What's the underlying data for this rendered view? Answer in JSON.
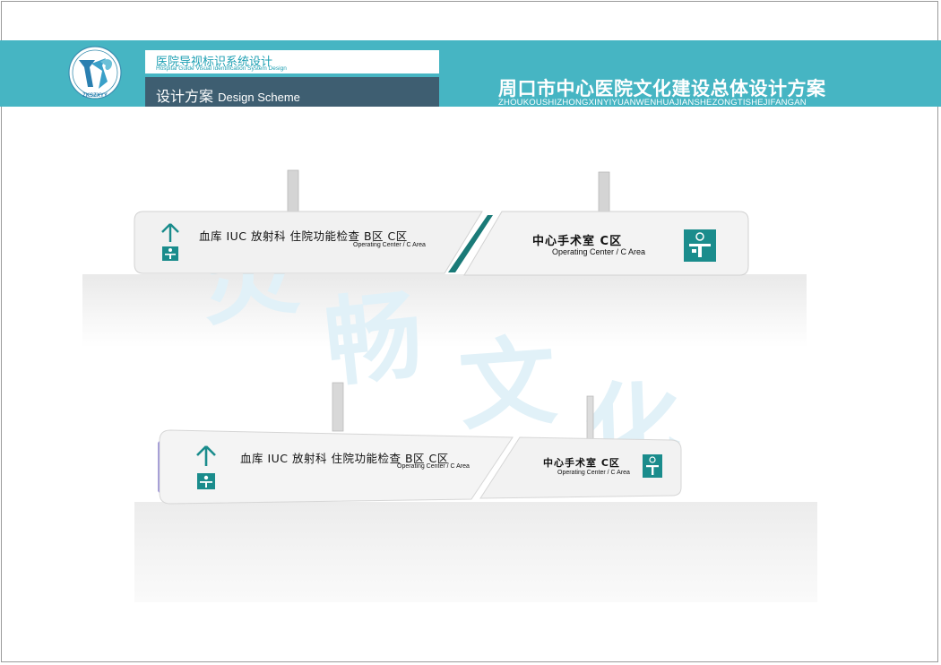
{
  "header": {
    "project_title_cn": "医院导视标识系统设计",
    "project_title_en": "Hospital Guide Visual Identification System Design",
    "section_cn": "设计方案",
    "section_en": "Design Scheme",
    "main_title": "周口市中心医院文化建设总体设计方案",
    "main_title_pinyin": "ZHOUKOUSHIZHONGXINYIYUANWENHUAJIANSHEZONGTISHEJIFANGAN",
    "logo_text": "ZKSZXYY"
  },
  "watermark": [
    "灵",
    "畅",
    "文",
    "化"
  ],
  "sign_top": {
    "left_panel": {
      "destinations": "血库 IUC 放射科 住院功能检查 B区 C区",
      "english": "Operating Center / C Area"
    },
    "right_panel": {
      "destination": "中心手术室 C区",
      "english": "Operating Center / C Area"
    }
  },
  "sign_bottom": {
    "left_panel": {
      "destinations": "血库 IUC 放射科 住院功能检查 B区 C区",
      "english": "Operating Center / C Area"
    },
    "right_panel": {
      "destination": "中心手术室 C区",
      "english": "Operating Center / C Area"
    }
  },
  "colors": {
    "header_band": "#46b5c3",
    "header_dark": "#3e5e71",
    "sign_accent": "#1a8c8c",
    "watermark": "#e1f1f8"
  },
  "icons": [
    "arrow-up-icon",
    "surgery-pictogram-icon",
    "hospital-logo-icon"
  ]
}
